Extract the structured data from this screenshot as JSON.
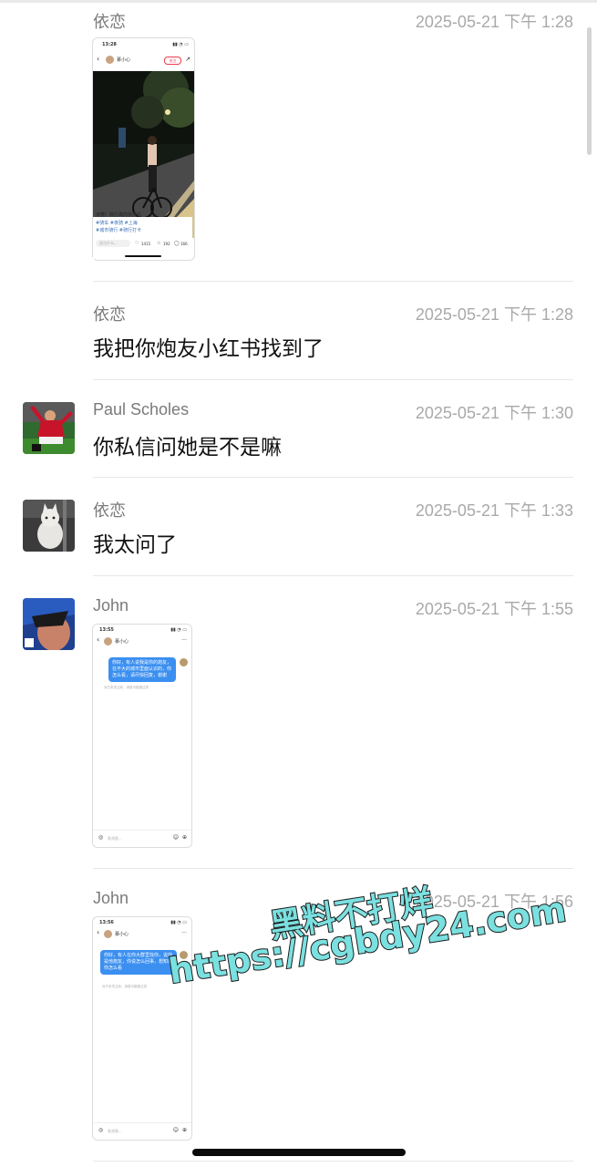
{
  "messages": [
    {
      "name": "依恋",
      "time": "2025-05-21 下午 1:28",
      "type": "image"
    },
    {
      "name": "依恋",
      "time": "2025-05-21 下午 1:28",
      "text": "我把你炮友小红书找到了"
    },
    {
      "name": "Paul Scholes",
      "time": "2025-05-21 下午 1:30",
      "text": "你私信问她是不是嘛"
    },
    {
      "name": "依恋",
      "time": "2025-05-21 下午 1:33",
      "text": "我太问了"
    },
    {
      "name": "John",
      "time": "2025-05-21 下午 1:55",
      "type": "image"
    },
    {
      "name": "John",
      "time": "2025-05-21 下午 1:56",
      "type": "image"
    }
  ],
  "thumb1": {
    "clock": "13:28",
    "user": "慕小心",
    "follow": "关注",
    "title": "渣慢！骑行真的很快乐",
    "tags1": "#骑车 #夜骑 #上海",
    "tags2": "#城市骑行 #骑行打卡",
    "comment_placeholder": "说点什么...",
    "likes": "1415",
    "stars": "192",
    "comments": "166"
  },
  "thumb2": {
    "clock": "13:55",
    "user": "慕小心",
    "bubble": "你好，有人说我是你的炮友，在不大的城市里面认识的，你怎么看，请尽快回复，谢谢",
    "note": "对方未关注你，消息可能被过滤",
    "input_placeholder": "发消息..."
  },
  "thumb3": {
    "clock": "13:56",
    "user": "慕小心",
    "bubble": "你好，有人在你大群里找你，说你是他炮友，你说怎么回事，想知道你怎么看",
    "note": "对方未关注你，消息可能被过滤",
    "input_placeholder": "发消息..."
  },
  "watermark": {
    "line1": "黑料不打烊",
    "line2": "https://cgbdy24.com"
  }
}
